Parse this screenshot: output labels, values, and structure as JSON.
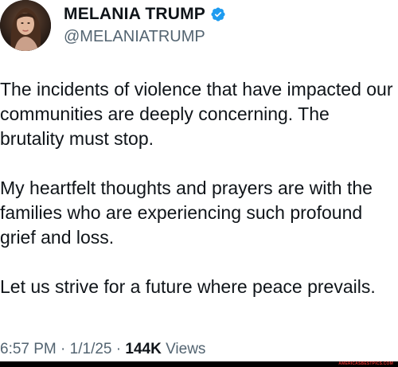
{
  "author": {
    "display_name": "MELANIA TRUMP",
    "handle": "@MELANIATRUMP",
    "avatar_icon": "profile-photo",
    "verified_icon": "verified-badge-icon",
    "verified_color": "#1d9bf0"
  },
  "tweet": {
    "paragraphs": [
      "The incidents of violence that have impacted our communities are deeply concerning. The brutality must stop.",
      "My heartfelt thoughts and prayers are with the families who are experiencing such profound grief and loss.",
      "Let us strive for a future where peace prevails."
    ]
  },
  "meta": {
    "time": "6:57 PM",
    "separator": "·",
    "date": "1/1/25",
    "views_count": "144K",
    "views_label": "Views"
  },
  "watermark": {
    "text": "AMERICASBESTPICS.COM",
    "color": "#d9302c"
  }
}
